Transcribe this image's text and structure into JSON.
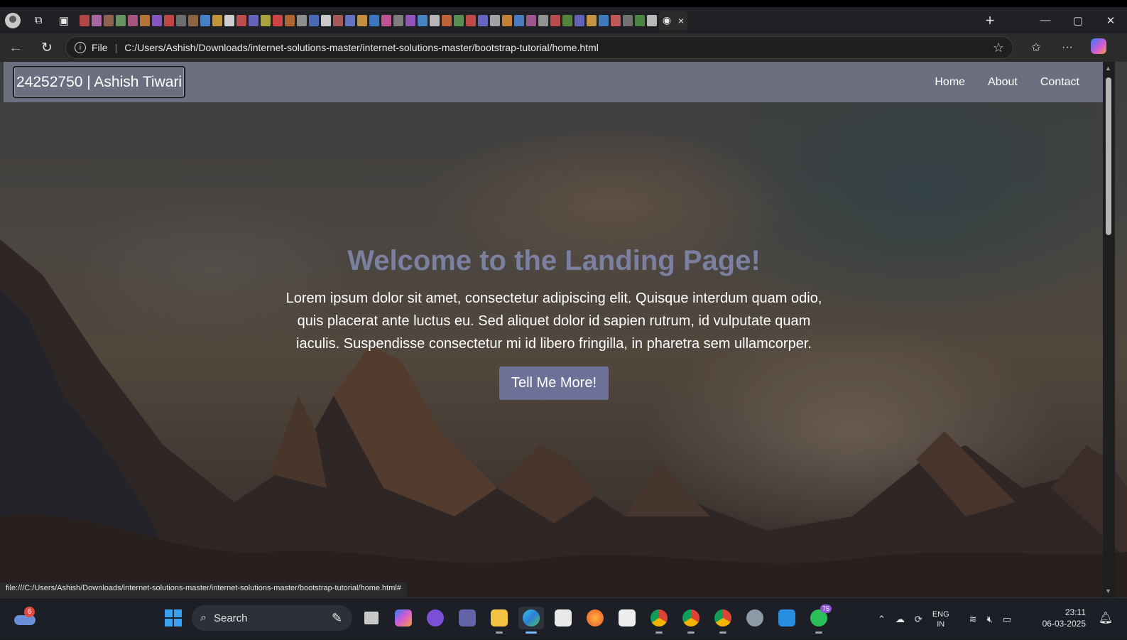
{
  "browser": {
    "window_controls": {
      "minimize": "—",
      "maximize": "▢",
      "close": "✕"
    },
    "new_tab": "+",
    "tab_close": "×",
    "address": {
      "scheme_label": "File",
      "url": "C:/Users/Ashish/Downloads/internet-solutions-master/internet-solutions-master/bootstrap-tutorial/home.html"
    },
    "status_url": "file:///C:/Users/Ashish/Downloads/internet-solutions-master/internet-solutions-master/bootstrap-tutorial/home.html#"
  },
  "site": {
    "brand": "24252750 | Ashish Tiwari",
    "nav": [
      "Home",
      "About",
      "Contact"
    ],
    "hero": {
      "title": "Welcome to the Landing Page!",
      "text": "Lorem ipsum dolor sit amet, consectetur adipiscing elit. Quisque interdum quam odio, quis placerat ante luctus eu. Sed aliquet dolor id sapien rutrum, id vulputate quam iaculis. Suspendisse consectetur mi id libero fringilla, in pharetra sem ullamcorper.",
      "button": "Tell Me More!"
    },
    "colors": {
      "navbar": "#6b6f80",
      "title": "#7b7fa0",
      "button": "#6d7197"
    }
  },
  "taskbar": {
    "weather_badge": "6",
    "search_placeholder": "Search",
    "whatsapp_badge": "75",
    "lang_top": "ENG",
    "lang_bottom": "IN",
    "time": "23:11",
    "date": "06-03-2025",
    "apps": [
      "task-view",
      "copilot",
      "meta",
      "teams",
      "file-explorer",
      "edge",
      "store",
      "firefox",
      "amazon",
      "chrome",
      "chrome",
      "chrome",
      "settings",
      "vscode",
      "whatsapp"
    ]
  }
}
